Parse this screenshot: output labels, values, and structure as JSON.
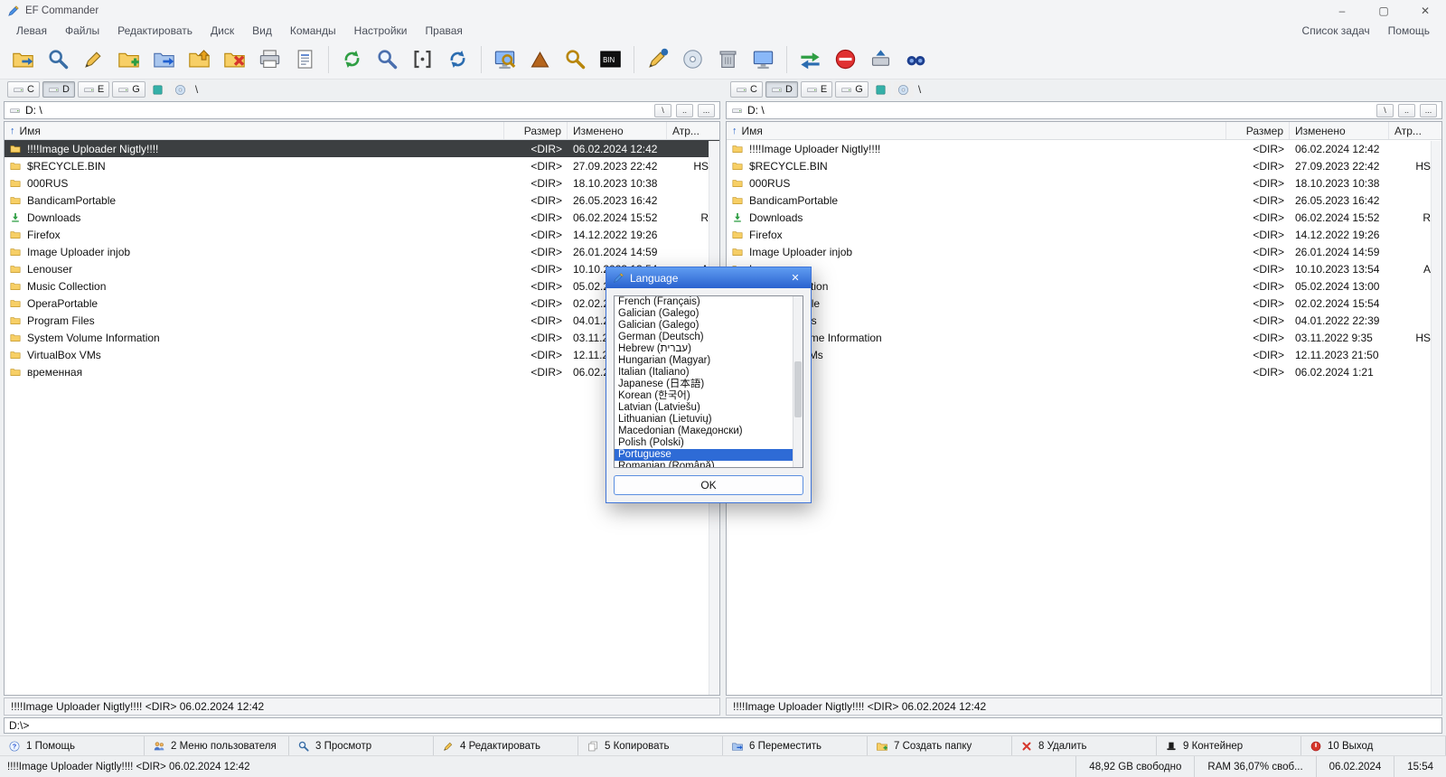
{
  "window": {
    "title": "EF Commander"
  },
  "titlebar": {
    "minimize": "–",
    "maximize": "▢",
    "close": "✕"
  },
  "menu": {
    "left": [
      "Левая",
      "Файлы",
      "Редактировать",
      "Диск",
      "Вид",
      "Команды",
      "Настройки",
      "Правая"
    ],
    "right": [
      "Список задач",
      "Помощь"
    ]
  },
  "toolbar": {
    "icons": [
      {
        "name": "connect"
      },
      {
        "name": "search"
      },
      {
        "name": "edit"
      },
      {
        "name": "copy"
      },
      {
        "name": "move"
      },
      {
        "name": "pack"
      },
      {
        "name": "delete"
      },
      {
        "name": "print"
      },
      {
        "name": "properties"
      },
      {
        "name": "refresh"
      },
      {
        "name": "find"
      },
      {
        "name": "select"
      },
      {
        "name": "reload"
      },
      {
        "name": "quick-view"
      },
      {
        "name": "chart"
      },
      {
        "name": "find-files"
      },
      {
        "name": "dos"
      },
      {
        "name": "notes"
      },
      {
        "name": "burn"
      },
      {
        "name": "archive"
      },
      {
        "name": "desktop"
      },
      {
        "name": "sync"
      },
      {
        "name": "stop"
      },
      {
        "name": "eject"
      },
      {
        "name": "plugins"
      }
    ]
  },
  "drivebar": {
    "drives": [
      "C",
      "D",
      "E",
      "G"
    ],
    "active": "D",
    "extras": [
      "network-drive",
      "cd-drive"
    ],
    "root_label": "\\"
  },
  "pane": {
    "path": "D: \\",
    "path_buttons": [
      "\\",
      "..",
      "..."
    ],
    "status": "!!!!Image Uploader Nigtly!!!!   <DIR> 06.02.2024 12:42"
  },
  "files": {
    "columns": [
      "Имя",
      "Размер",
      "Изменено",
      "Атр..."
    ],
    "sort_arrow": "↑",
    "selected": {
      "pane": 0,
      "row": 0
    },
    "rows": [
      {
        "name": "!!!!Image Uploader Nigtly!!!!",
        "size": "<DIR>",
        "modified": "06.02.2024 12:42",
        "attr": "",
        "icon": "folder"
      },
      {
        "name": "$RECYCLE.BIN",
        "size": "<DIR>",
        "modified": "27.09.2023 22:42",
        "attr": "HS",
        "icon": "folder"
      },
      {
        "name": "000RUS",
        "size": "<DIR>",
        "modified": "18.10.2023 10:38",
        "attr": "",
        "icon": "folder"
      },
      {
        "name": "BandicamPortable",
        "size": "<DIR>",
        "modified": "26.05.2023 16:42",
        "attr": "",
        "icon": "folder"
      },
      {
        "name": "Downloads",
        "size": "<DIR>",
        "modified": "06.02.2024 15:52",
        "attr": "R",
        "icon": "download"
      },
      {
        "name": "Firefox",
        "size": "<DIR>",
        "modified": "14.12.2022 19:26",
        "attr": "",
        "icon": "folder"
      },
      {
        "name": "Image Uploader injob",
        "size": "<DIR>",
        "modified": "26.01.2024 14:59",
        "attr": "",
        "icon": "folder"
      },
      {
        "name": "Lenouser",
        "size": "<DIR>",
        "modified": "10.10.2023 13:54",
        "attr": "A",
        "icon": "folder"
      },
      {
        "name": "Music Collection",
        "size": "<DIR>",
        "modified": "05.02.2024 13:00",
        "attr": "",
        "icon": "folder"
      },
      {
        "name": "OperaPortable",
        "size": "<DIR>",
        "modified": "02.02.2024 15:54",
        "attr": "",
        "icon": "folder"
      },
      {
        "name": "Program Files",
        "size": "<DIR>",
        "modified": "04.01.2022 22:39",
        "attr": "",
        "icon": "folder"
      },
      {
        "name": "System Volume Information",
        "size": "<DIR>",
        "modified": "03.11.2022 9:35",
        "attr": "HS",
        "icon": "folder"
      },
      {
        "name": "VirtualBox VMs",
        "size": "<DIR>",
        "modified": "12.11.2023 21:50",
        "attr": "",
        "icon": "folder"
      },
      {
        "name": "временная",
        "size": "<DIR>",
        "modified": "06.02.2024 1:21",
        "attr": "",
        "icon": "folder"
      }
    ]
  },
  "dialog": {
    "title": "Language",
    "close": "✕",
    "items": [
      "French (Français)",
      "Galician (Galego)",
      "Galician (Galego)",
      "German (Deutsch)",
      "Hebrew (עברית)",
      "Hungarian (Magyar)",
      "Italian (Italiano)",
      "Japanese (日本語)",
      "Korean (한국어)",
      "Latvian (Latviešu)",
      "Lithuanian (Lietuvių)",
      "Macedonian (Македонски)",
      "Polish (Polski)",
      "Portuguese",
      "Romanian (Română)"
    ],
    "selected_index": 13,
    "ok_label": "OK"
  },
  "cmdline": {
    "prompt": "D:\\>"
  },
  "fnkeys": [
    {
      "label": "1 Помощь",
      "icon": "help"
    },
    {
      "label": "2 Меню пользователя",
      "icon": "users"
    },
    {
      "label": "3 Просмотр",
      "icon": "view"
    },
    {
      "label": "4 Редактировать",
      "icon": "edit"
    },
    {
      "label": "5 Копировать",
      "icon": "copy-files"
    },
    {
      "label": "6 Переместить",
      "icon": "move-files"
    },
    {
      "label": "7 Создать папку",
      "icon": "new-folder"
    },
    {
      "label": "8 Удалить",
      "icon": "delete-red"
    },
    {
      "label": "9 Контейнер",
      "icon": "container"
    },
    {
      "label": "10 Выход",
      "icon": "exit"
    }
  ],
  "statusbar": {
    "left": "!!!!Image Uploader Nigtly!!!!   <DIR> 06.02.2024 12:42",
    "segments": [
      "48,92 GB свободно",
      "RAM 36,07% своб...",
      "06.02.2024",
      "15:54"
    ]
  }
}
